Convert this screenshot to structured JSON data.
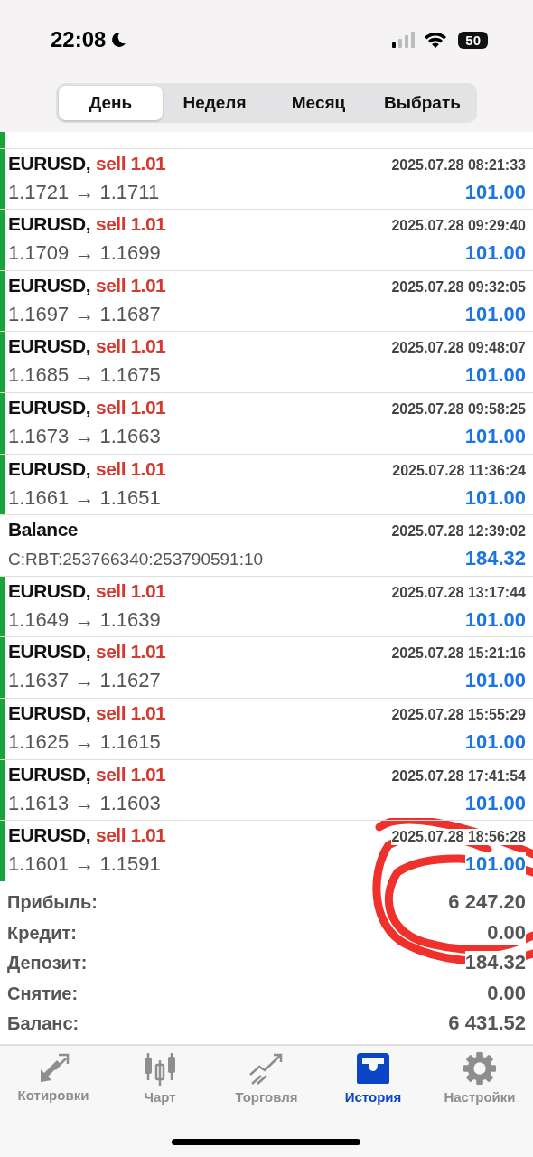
{
  "status_bar": {
    "time": "22:08",
    "battery": "50"
  },
  "period_tabs": [
    {
      "label": "День",
      "selected": true
    },
    {
      "label": "Неделя",
      "selected": false
    },
    {
      "label": "Месяц",
      "selected": false
    },
    {
      "label": "Выбрать",
      "selected": false
    }
  ],
  "partial_row": {
    "kind": "trade"
  },
  "rows": [
    {
      "kind": "trade",
      "symbol": "EURUSD,",
      "order": "sell 1.01",
      "time": "2025.07.28 08:21:33",
      "prices": "1.1721 → 1.1711",
      "profit": "101.00"
    },
    {
      "kind": "trade",
      "symbol": "EURUSD,",
      "order": "sell 1.01",
      "time": "2025.07.28 09:29:40",
      "prices": "1.1709 → 1.1699",
      "profit": "101.00"
    },
    {
      "kind": "trade",
      "symbol": "EURUSD,",
      "order": "sell 1.01",
      "time": "2025.07.28 09:32:05",
      "prices": "1.1697 → 1.1687",
      "profit": "101.00"
    },
    {
      "kind": "trade",
      "symbol": "EURUSD,",
      "order": "sell 1.01",
      "time": "2025.07.28 09:48:07",
      "prices": "1.1685 → 1.1675",
      "profit": "101.00"
    },
    {
      "kind": "trade",
      "symbol": "EURUSD,",
      "order": "sell 1.01",
      "time": "2025.07.28 09:58:25",
      "prices": "1.1673 → 1.1663",
      "profit": "101.00"
    },
    {
      "kind": "trade",
      "symbol": "EURUSD,",
      "order": "sell 1.01",
      "time": "2025.07.28 11:36:24",
      "prices": "1.1661 → 1.1651",
      "profit": "101.00"
    },
    {
      "kind": "balance",
      "symbol": "Balance",
      "time": "2025.07.28 12:39:02",
      "prices": "C:RBT:253766340:253790591:10",
      "profit": "184.32"
    },
    {
      "kind": "trade",
      "symbol": "EURUSD,",
      "order": "sell 1.01",
      "time": "2025.07.28 13:17:44",
      "prices": "1.1649 → 1.1639",
      "profit": "101.00"
    },
    {
      "kind": "trade",
      "symbol": "EURUSD,",
      "order": "sell 1.01",
      "time": "2025.07.28 15:21:16",
      "prices": "1.1637 → 1.1627",
      "profit": "101.00"
    },
    {
      "kind": "trade",
      "symbol": "EURUSD,",
      "order": "sell 1.01",
      "time": "2025.07.28 15:55:29",
      "prices": "1.1625 → 1.1615",
      "profit": "101.00"
    },
    {
      "kind": "trade",
      "symbol": "EURUSD,",
      "order": "sell 1.01",
      "time": "2025.07.28 17:41:54",
      "prices": "1.1613 → 1.1603",
      "profit": "101.00"
    },
    {
      "kind": "trade",
      "symbol": "EURUSD,",
      "order": "sell 1.01",
      "time": "2025.07.28 18:56:28",
      "prices": "1.1601 → 1.1591",
      "profit": "101.00"
    }
  ],
  "summary": [
    {
      "label": "Прибыль:",
      "value": "6 247.20"
    },
    {
      "label": "Кредит:",
      "value": "0.00"
    },
    {
      "label": "Депозит:",
      "value": "184.32"
    },
    {
      "label": "Снятие:",
      "value": "0.00"
    },
    {
      "label": "Баланс:",
      "value": "6 431.52"
    }
  ],
  "tab_bar": [
    {
      "label": "Котировки",
      "selected": false
    },
    {
      "label": "Чарт",
      "selected": false
    },
    {
      "label": "Торговля",
      "selected": false
    },
    {
      "label": "История",
      "selected": true
    },
    {
      "label": "Настройки",
      "selected": false
    }
  ]
}
